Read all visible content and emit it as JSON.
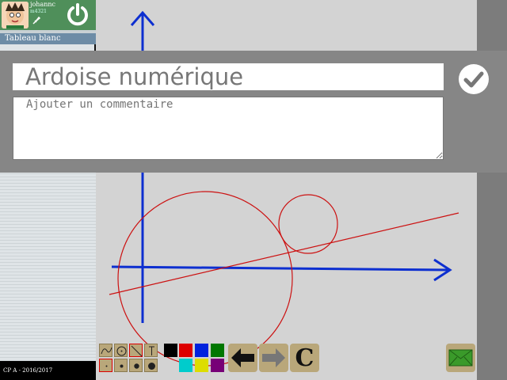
{
  "user": {
    "name": "johannc",
    "code": "m4321",
    "avatar": "avatar-face",
    "power_icon": "power-icon",
    "rocket_icon": "rocket-icon"
  },
  "sidebar": {
    "tab_label": "Tableau blanc",
    "footer": "CP A - 2016/2017"
  },
  "dialog": {
    "title_value": "Ardoise numérique",
    "comment_placeholder": "Ajouter un commentaire",
    "confirm_icon": "checkmark-icon"
  },
  "toolbar": {
    "shape_tools": [
      "freehand-tool-icon",
      "circle-tool-icon",
      "line-tool-icon",
      "text-tool-icon"
    ],
    "brush_sizes": [
      "size-1-icon",
      "size-2-icon",
      "size-3-icon",
      "size-4-icon"
    ],
    "colors_row1": [
      "#000000",
      "#dd0000",
      "#0022dd",
      "#007700"
    ],
    "colors_row2": [
      "#00cccc",
      "#dddd00",
      "#770077"
    ],
    "undo_icon": "arrow-left-icon",
    "redo_icon": "arrow-right-icon",
    "clear_label": "C",
    "send_icon": "envelope-icon"
  },
  "colors": {
    "axis": "#0d2fd0",
    "sketch": "#cc1111",
    "sidebar_header": "#4f8f5a",
    "tab": "#6d8ca6",
    "tool": "#b9a77a"
  }
}
